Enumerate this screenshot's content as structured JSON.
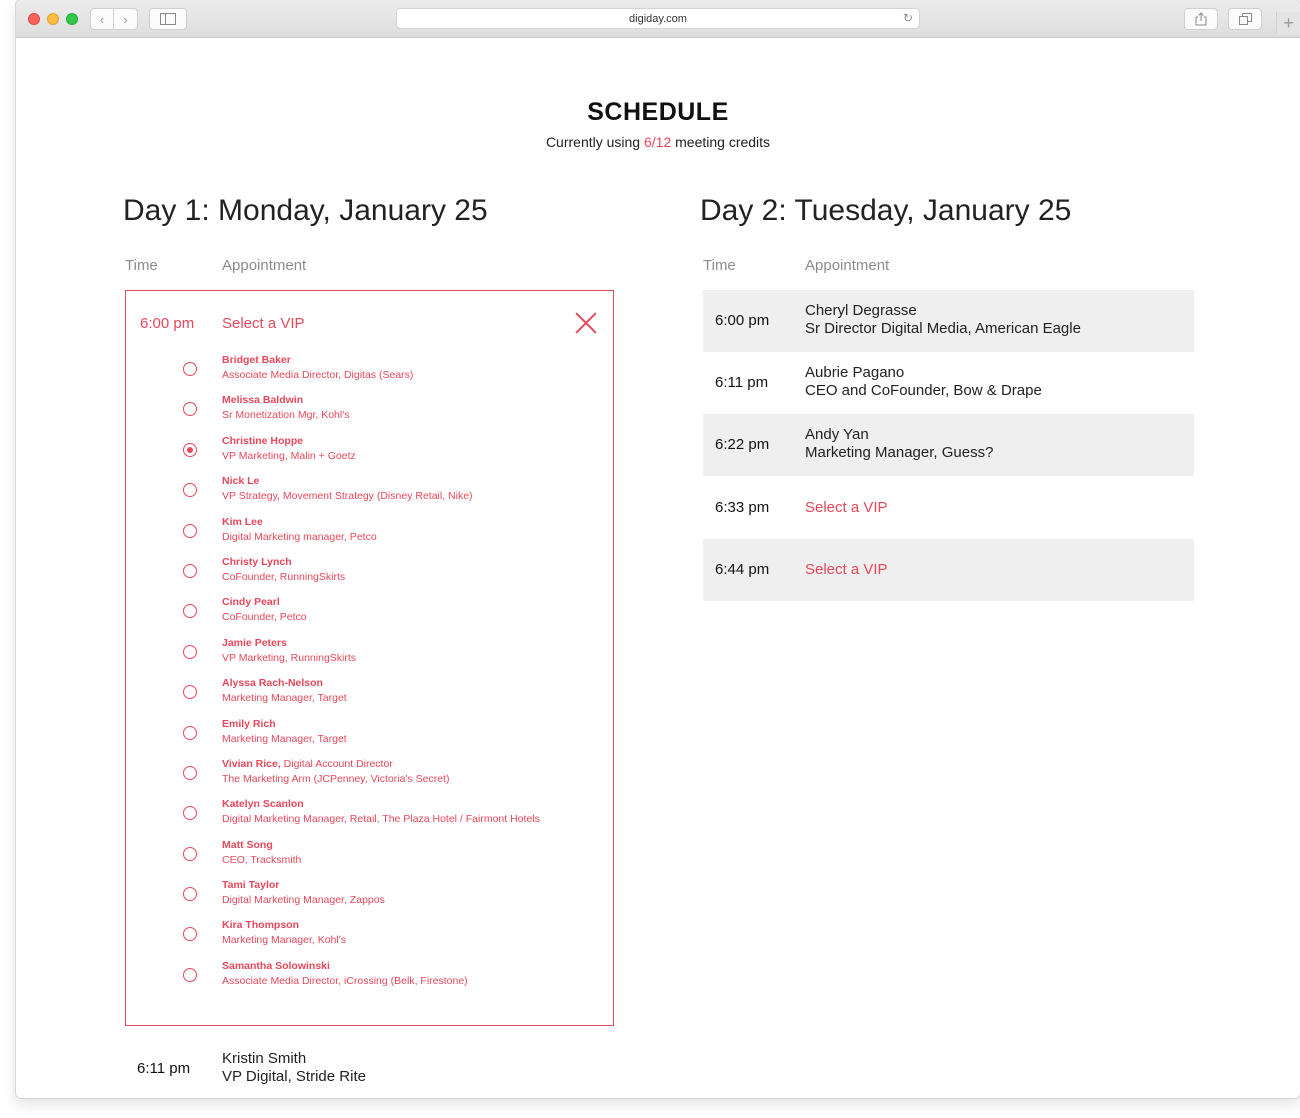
{
  "browser": {
    "url": "digiday.com"
  },
  "page": {
    "title": "SCHEDULE",
    "credits_prefix": "Currently using ",
    "credits_value": "6/12",
    "credits_suffix": " meeting credits"
  },
  "colors": {
    "accent": "#e8485b",
    "row_shade": "#efefef"
  },
  "day1": {
    "heading": "Day 1: Monday, January 25",
    "col_time": "Time",
    "col_appointment": "Appointment",
    "vip_select": {
      "time": "6:00 pm",
      "title": "Select a VIP",
      "selected_index": 2,
      "options": [
        {
          "name": "Bridget Baker",
          "inline": "",
          "detail": "Associate Media Director, Digitas (Sears)"
        },
        {
          "name": "Melissa Baldwin",
          "inline": "",
          "detail": "Sr Monetization Mgr, Kohl's"
        },
        {
          "name": "Christine Hoppe",
          "inline": "",
          "detail": "VP Marketing, Malin + Goetz"
        },
        {
          "name": "Nick Le",
          "inline": "",
          "detail": "VP Strategy, Movement Strategy (Disney Retail, Nike)"
        },
        {
          "name": "Kim Lee",
          "inline": "",
          "detail": "Digital Marketing manager, Petco"
        },
        {
          "name": "Christy Lynch",
          "inline": "",
          "detail": "CoFounder, RunningSkirts"
        },
        {
          "name": "Cindy Pearl",
          "inline": "",
          "detail": "CoFounder, Petco"
        },
        {
          "name": "Jamie Peters",
          "inline": "",
          "detail": "VP Marketing, RunningSkirts"
        },
        {
          "name": "Alyssa Rach-Nelson",
          "inline": "",
          "detail": "Marketing Manager, Target"
        },
        {
          "name": "Emily Rich",
          "inline": "",
          "detail": "Marketing Manager, Target"
        },
        {
          "name": "Vivian Rice,",
          "inline": " Digital Account Director",
          "detail": "The Marketing Arm (JCPenney, Victoria's Secret)"
        },
        {
          "name": "Katelyn Scanlon",
          "inline": "",
          "detail": "Digital Marketing Manager, Retail, The Plaza Hotel / Fairmont Hotels"
        },
        {
          "name": "Matt Song",
          "inline": "",
          "detail": "CEO, Tracksmith"
        },
        {
          "name": "Tami Taylor",
          "inline": "",
          "detail": "Digital Marketing Manager, Zappos"
        },
        {
          "name": "Kira Thompson",
          "inline": "",
          "detail": "Marketing Manager, Kohl's"
        },
        {
          "name": "Samantha Solowinski",
          "inline": "",
          "detail": "Associate Media Director, iCrossing (Belk, Firestone)"
        }
      ]
    },
    "next_row": {
      "time": "6:11 pm",
      "name": "Kristin Smith",
      "title": "VP Digital, Stride Rite"
    }
  },
  "day2": {
    "heading": "Day 2: Tuesday, January 25",
    "col_time": "Time",
    "col_appointment": "Appointment",
    "rows": [
      {
        "time": "6:00 pm",
        "name": "Cheryl Degrasse",
        "title": "Sr Director Digital Media, American Eagle",
        "select": ""
      },
      {
        "time": "6:11 pm",
        "name": "Aubrie Pagano",
        "title": "CEO and CoFounder, Bow & Drape",
        "select": ""
      },
      {
        "time": "6:22 pm",
        "name": "Andy Yan",
        "title": "Marketing Manager, Guess?",
        "select": ""
      },
      {
        "time": "6:33 pm",
        "name": "",
        "title": "",
        "select": "Select a VIP"
      },
      {
        "time": "6:44 pm",
        "name": "",
        "title": "",
        "select": "Select a VIP"
      }
    ]
  }
}
